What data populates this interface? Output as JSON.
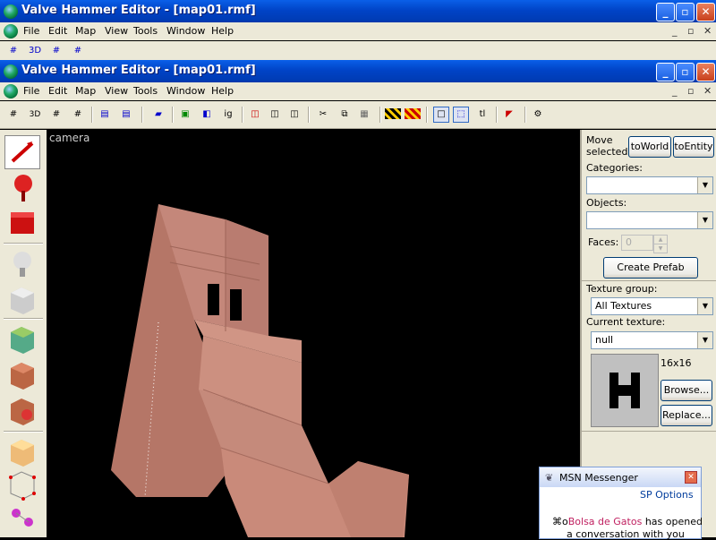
{
  "outer_window": {
    "title": "Valve Hammer Editor - [map01.rmf]",
    "controls": [
      "_",
      "▫",
      "✕"
    ]
  },
  "outer_menu": [
    "File",
    "Edit",
    "Map",
    "View",
    "Tools",
    "Window",
    "Help"
  ],
  "inner_window": {
    "title": "Valve Hammer Editor - [map01.rmf]",
    "controls": [
      "_",
      "▫",
      "✕"
    ]
  },
  "inner_menu": [
    "File",
    "Edit",
    "Map",
    "View",
    "Tools",
    "Window",
    "Help"
  ],
  "mdi_controls": [
    "_",
    "▫",
    "✕"
  ],
  "toolbar": {
    "grid_3d_label": "3D",
    "ig_label": "ig",
    "tl_label": "tl"
  },
  "viewport": {
    "label": "camera"
  },
  "right_panel": {
    "move_selected": "Move selected:",
    "to_world": "toWorld",
    "to_entity": "toEntity",
    "categories_label": "Categories:",
    "categories_value": "",
    "objects_label": "Objects:",
    "objects_value": "",
    "faces_label": "Faces:",
    "faces_value": "0",
    "create_prefab": "Create Prefab",
    "texture_group_label": "Texture group:",
    "texture_group_value": "All Textures",
    "current_texture_label": "Current texture:",
    "current_texture_value": "null",
    "texture_size": "16x16",
    "browse": "Browse...",
    "replace": "Replace..."
  },
  "msn": {
    "title": "MSN Messenger",
    "options": "Options",
    "message_name": "Bolsa de Gatos",
    "message_rest": " has opened",
    "message_line2": "a conversation with you"
  },
  "colors": {
    "titlebar_blue": "#0043c6",
    "panel_bg": "#ece9d8",
    "brush_color": "#c98a7a",
    "msn_name": "#c02060"
  }
}
